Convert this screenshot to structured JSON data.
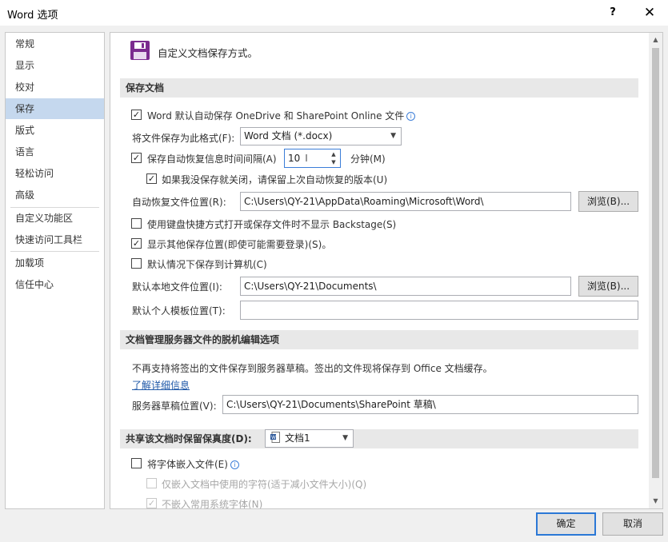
{
  "window": {
    "title": "Word 选项",
    "help_glyph": "?",
    "close_glyph": "✕"
  },
  "sidebar": {
    "items": [
      {
        "label": "常规"
      },
      {
        "label": "显示"
      },
      {
        "label": "校对"
      },
      {
        "label": "保存",
        "active": true
      },
      {
        "label": "版式"
      },
      {
        "label": "语言"
      },
      {
        "label": "轻松访问"
      },
      {
        "label": "高级"
      },
      {
        "label": "自定义功能区"
      },
      {
        "label": "快速访问工具栏"
      },
      {
        "label": "加载项"
      },
      {
        "label": "信任中心"
      }
    ]
  },
  "main": {
    "header": {
      "icon": "floppy-disk-icon",
      "text": "自定义文档保存方式。"
    },
    "save_docs": {
      "title": "保存文档",
      "autosave_label": "Word 默认自动保存 OneDrive 和 SharePoint Online 文件",
      "autosave_checked": true,
      "format_label": "将文件保存为此格式(F):",
      "format_value": "Word 文档 (*.docx)",
      "autorecover_label": "保存自动恢复信息时间间隔(A)",
      "autorecover_checked": true,
      "autorecover_minutes": "10",
      "minutes_label": "分钟(M)",
      "keep_last_label": "如果我没保存就关闭，请保留上次自动恢复的版本(U)",
      "keep_last_checked": true,
      "autorecover_loc_label": "自动恢复文件位置(R):",
      "autorecover_loc_value": "C:\\Users\\QY-21\\AppData\\Roaming\\Microsoft\\Word\\",
      "browse_label": "浏览(B)...",
      "no_backstage_label": "使用键盘快捷方式打开或保存文件时不显示 Backstage(S)",
      "no_backstage_checked": false,
      "show_other_label": "显示其他保存位置(即使可能需要登录)(S)。",
      "show_other_checked": true,
      "save_local_label": "默认情况下保存到计算机(C)",
      "save_local_checked": false,
      "local_loc_label": "默认本地文件位置(I):",
      "local_loc_value": "C:\\Users\\QY-21\\Documents\\",
      "browse_label_2": "浏览(B)...",
      "template_loc_label": "默认个人模板位置(T):",
      "template_loc_value": ""
    },
    "offline": {
      "title": "文档管理服务器文件的脱机编辑选项",
      "notice": "不再支持将签出的文件保存到服务器草稿。签出的文件现将保存到 Office 文档缓存。",
      "learn_more": "了解详细信息",
      "drafts_label": "服务器草稿位置(V):",
      "drafts_value": "C:\\Users\\QY-21\\Documents\\SharePoint 草稿\\"
    },
    "fidelity": {
      "title": "共享该文档时保留保真度(D):",
      "doc_value": "文档1",
      "embed_fonts_label": "将字体嵌入文件(E)",
      "embed_fonts_checked": false,
      "embed_used_label": "仅嵌入文档中使用的字符(适于减小文件大小)(Q)",
      "embed_used_checked": false,
      "no_common_label": "不嵌入常用系统字体(N)",
      "no_common_checked": true
    }
  },
  "footer": {
    "ok_label": "确定",
    "cancel_label": "取消"
  },
  "colors": {
    "accent": "#2b78d6",
    "selected": "#c5d8ee",
    "link": "#1f58a8",
    "icon": "#7b2b8f"
  }
}
